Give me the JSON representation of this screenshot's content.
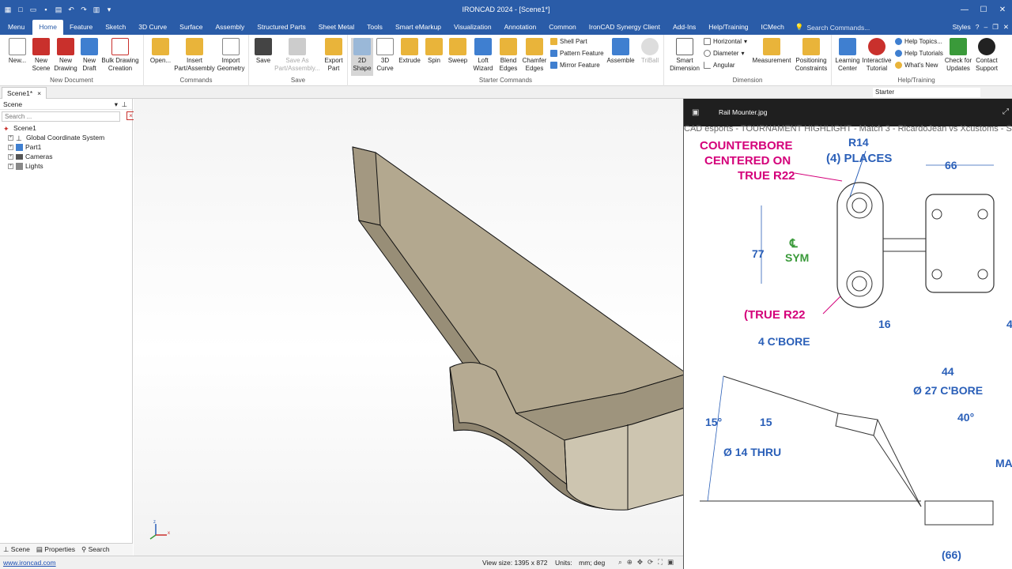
{
  "app": {
    "title": "IRONCAD 2024 - [Scene1*]",
    "qat_icons": [
      "app-logo-icon",
      "new-icon",
      "open-icon",
      "save-icon",
      "print-icon",
      "undo-icon",
      "redo-icon",
      "layout-icon",
      "settings-icon"
    ]
  },
  "tabs": [
    "Menu",
    "Home",
    "Feature",
    "Sketch",
    "3D Curve",
    "Surface",
    "Assembly",
    "Structured Parts",
    "Sheet Metal",
    "Tools",
    "Smart eMarkup",
    "Visualization",
    "Annotation",
    "Common",
    "IronCAD Synergy Client",
    "Add-Ins",
    "Help/Training",
    "ICMech"
  ],
  "active_tab": "Home",
  "search_placeholder": "Search Commands...",
  "styles_label": "Styles",
  "ribbon": {
    "groups": {
      "new_document": "New Document",
      "commands": "Commands",
      "save": "Save",
      "starter_commands": "Starter Commands",
      "dimension": "Dimension",
      "help_training": "Help/Training"
    },
    "buttons": {
      "new": "New...",
      "new_scene": "New Scene",
      "new_drawing": "New Drawing",
      "new_draft": "New Draft",
      "bulk_drawing": "Bulk Drawing Creation",
      "open": "Open...",
      "insert_part": "Insert Part/Assembly",
      "import_geometry": "Import Geometry",
      "save": "Save",
      "save_as": "Save As Part/Assembly...",
      "export_part": "Export Part",
      "shape_2d": "2D Shape",
      "curve_3d": "3D Curve",
      "extrude": "Extrude",
      "spin": "Spin",
      "sweep": "Sweep",
      "loft_wizard": "Loft Wizard",
      "blend_edges": "Blend Edges",
      "chamfer_edges": "Chamfer Edges",
      "shell_part": "Shell Part",
      "pattern_feature": "Pattern Feature",
      "mirror_feature": "Mirror Feature",
      "assemble": "Assemble",
      "triball": "TriBall",
      "smart_dimension": "Smart Dimension",
      "horizontal": "Horizontal",
      "diameter": "Diameter",
      "angular": "Angular",
      "measurement": "Measurement",
      "positioning_constraints": "Positioning Constraints",
      "learning_center": "Learning Center",
      "interactive_tutorial": "Interactive Tutorial",
      "help_topics": "Help Topics...",
      "help_tutorials": "Help Tutorials",
      "whats_new": "What's New",
      "check_updates": "Check for Updates",
      "contact_support": "Contact Support"
    }
  },
  "document_tab": "Scene1*",
  "starter_select": "Starter",
  "scene_panel": {
    "title": "Scene",
    "search_placeholder": "Search ...",
    "tree": [
      "Scene1",
      "Global Coordinate System",
      "Part1",
      "Cameras",
      "Lights"
    ],
    "bottom_tabs": [
      "Scene",
      "Properties",
      "Search"
    ]
  },
  "viewer": {
    "title": "Rail Mounter.jpg",
    "overlay_text": "CAD esports - TOURNAMENT HIGHLIGHT - Match 3 - RicardoJean vs Xcustoms - S",
    "annotations": {
      "counterbore": "COUNTERBORE CENTERED ON TRUE R22",
      "r14": "R14",
      "four_places": "(4) PLACES",
      "d66_top": "66",
      "d77": "77",
      "cl_sym": "SYM",
      "cl_mark": "℄",
      "true_r22": "(TRUE R22",
      "d16": "16",
      "d4_right": "4",
      "cbore4": "4 C'BORE",
      "d44": "44",
      "dia27": "Ø 27 C'BORE",
      "a15deg": "15°",
      "d15": "15",
      "a40deg": "40°",
      "dia14": "Ø 14 THRU",
      "ma": "MA",
      "d66_bottom": "(66)"
    }
  },
  "status": {
    "link": "www.ironcad.com",
    "view_size": "View size: 1395 x  872",
    "units_label": "Units:",
    "units_value": "mm; deg"
  },
  "colors": {
    "title_bar": "#2a5ca8",
    "part_face": "#b3a88f",
    "part_shadow": "#8f8570",
    "annotation_magenta": "#d4007a",
    "annotation_blue": "#2a5fb8"
  }
}
